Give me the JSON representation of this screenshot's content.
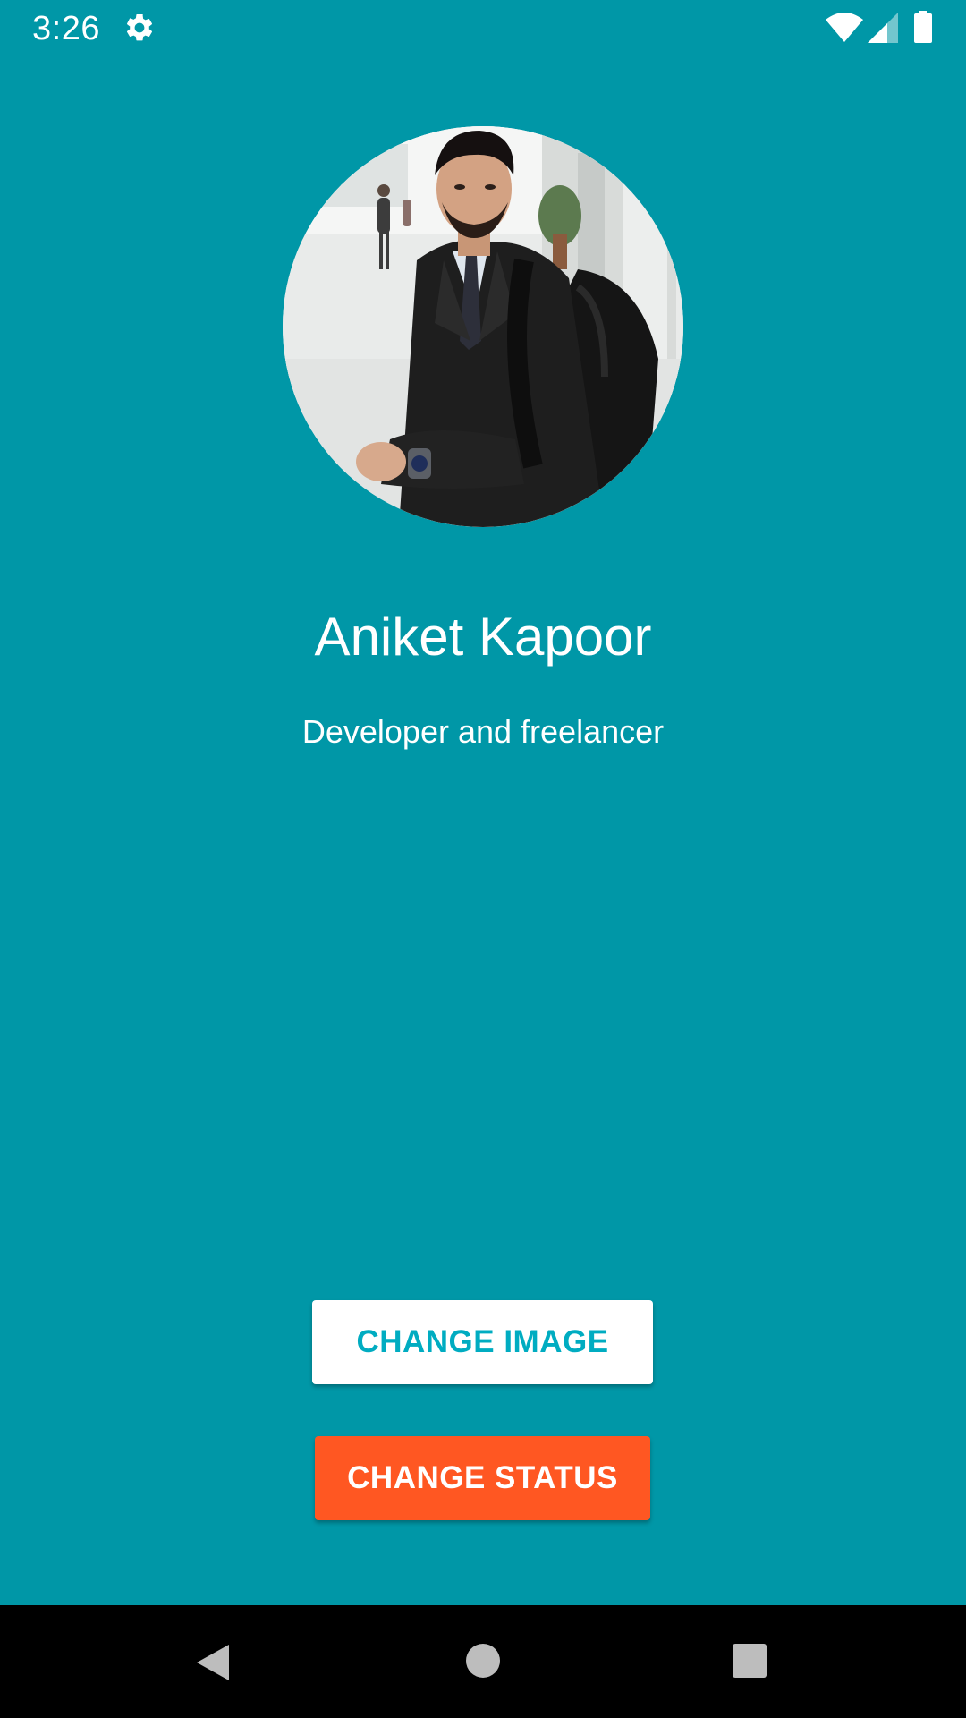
{
  "status_bar": {
    "time": "3:26",
    "icons": [
      "gear-icon",
      "wifi-icon",
      "cell-signal-icon",
      "battery-icon"
    ]
  },
  "profile": {
    "avatar_icon": "profile-photo",
    "name": "Aniket Kapoor",
    "status": "Developer and freelancer"
  },
  "actions": {
    "change_image_label": "CHANGE IMAGE",
    "change_status_label": "CHANGE STATUS"
  },
  "nav_bar": {
    "icons": [
      "back-icon",
      "home-icon",
      "recents-icon"
    ]
  },
  "colors": {
    "background": "#0097a7",
    "change_image_text": "#00acc1",
    "change_image_bg": "#ffffff",
    "change_status_bg": "#ff5722",
    "nav_bar_bg": "#000000"
  }
}
